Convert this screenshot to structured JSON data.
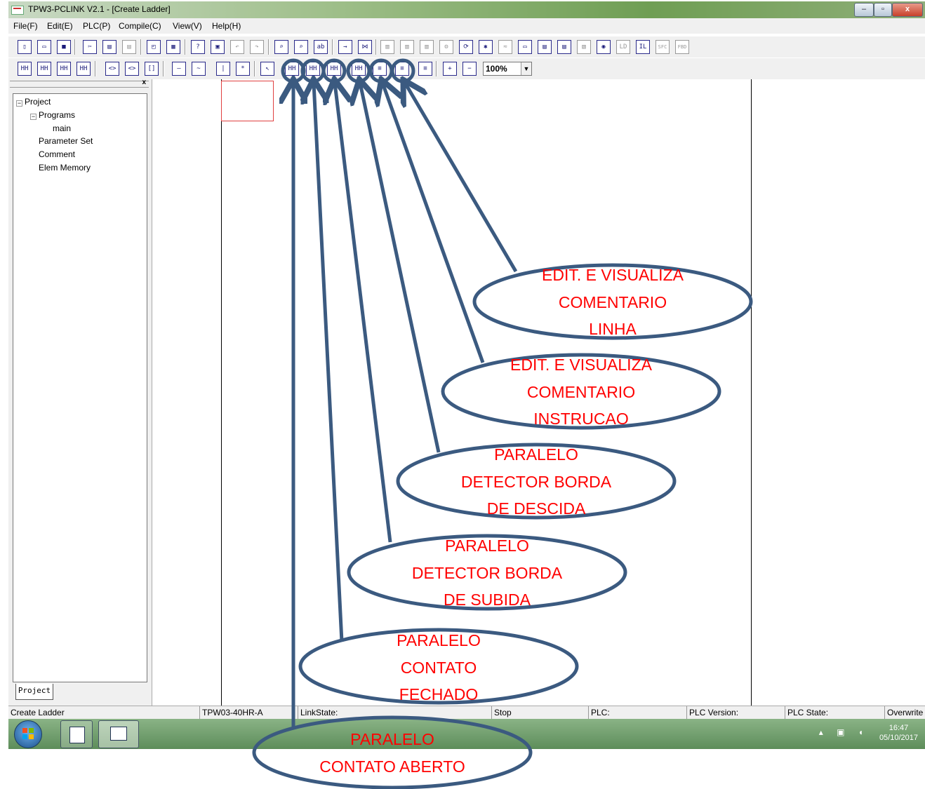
{
  "window": {
    "title": "TPW3-PCLINK V2.1 - [Create Ladder]",
    "controls": [
      "–",
      "▫",
      "x"
    ]
  },
  "menu": [
    "File(F)",
    "Edit(E)",
    "PLC(P)",
    "Compile(C)",
    "View(V)",
    "Help(H)"
  ],
  "toolbar2": {
    "buttons": [
      "HH",
      "HH",
      "HH",
      "HH",
      "<>",
      "<>",
      "[]",
      "—",
      "~",
      "|",
      "*",
      "↖",
      "HH",
      "HH",
      "HH",
      "HH",
      "≡",
      "≡",
      "≡",
      "+",
      "−"
    ],
    "zoom": "100%"
  },
  "toolbar1": {
    "mode_buttons": [
      "LD",
      "IL",
      "SFC",
      "FBD"
    ]
  },
  "project_panel": {
    "close": "x",
    "tree": {
      "root": "Project",
      "programs": "Programs",
      "main": "main",
      "parameter_set": "Parameter Set",
      "comment": "Comment",
      "elem_memory": "Elem Memory"
    },
    "tab": "Project"
  },
  "statusbar": {
    "mode": "Create Ladder",
    "model": "TPW03-40HR-A",
    "link_state": "LinkState:",
    "run_state": "Stop",
    "plc": "PLC:",
    "plc_version": "PLC Version:",
    "plc_state": "PLC State:",
    "overwrite": "Overwrite"
  },
  "taskbar": {
    "time": "16:47",
    "date": "05/10/2017"
  },
  "annotations": {
    "line_comment": [
      "EDIT. E VISUALIZA",
      "COMENTARIO",
      "LINHA"
    ],
    "instruction_comment": [
      "EDIT. E VISUALIZA",
      "COMENTARIO",
      "INSTRUCAO"
    ],
    "falling_edge": [
      "PARALELO",
      "DETECTOR BORDA",
      "DE DESCIDA"
    ],
    "rising_edge": [
      "PARALELO",
      "DETECTOR BORDA",
      "DE SUBIDA"
    ],
    "closed_contact": [
      "PARALELO",
      "CONTATO",
      "FECHADO"
    ],
    "open_contact": [
      "PARALELO",
      "CONTATO ABERTO"
    ]
  },
  "colors": {
    "annotation_text": "#ff0000",
    "annotation_stroke": "#3b5a80"
  }
}
